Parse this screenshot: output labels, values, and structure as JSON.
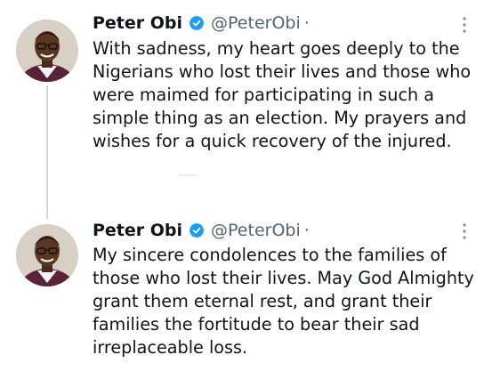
{
  "tweets": [
    {
      "author_name": "Peter Obi",
      "handle": "@PeterObi",
      "separator": "·",
      "verified_icon": "verified-badge-icon",
      "more_icon": "more-options-icon",
      "text": "With sadness, my heart goes deeply to the\nNigerians who lost their lives and those who\nwere maimed for participating in such a\nsimple thing as an election. My prayers and\nwishes for a quick recovery of the injured."
    },
    {
      "author_name": "Peter Obi",
      "handle": "@PeterObi",
      "separator": "·",
      "verified_icon": "verified-badge-icon",
      "more_icon": "more-options-icon",
      "text": "My sincere condolences to the families of\nthose who lost their lives. May God Almighty\ngrant them eternal rest, and grant their\nfamilies the fortitude to bear their sad\nirreplaceable loss."
    }
  ],
  "colors": {
    "text": "#0f1419",
    "secondary": "#536471",
    "verified": "#1d9bf0",
    "thread_line": "#cfd9de"
  }
}
